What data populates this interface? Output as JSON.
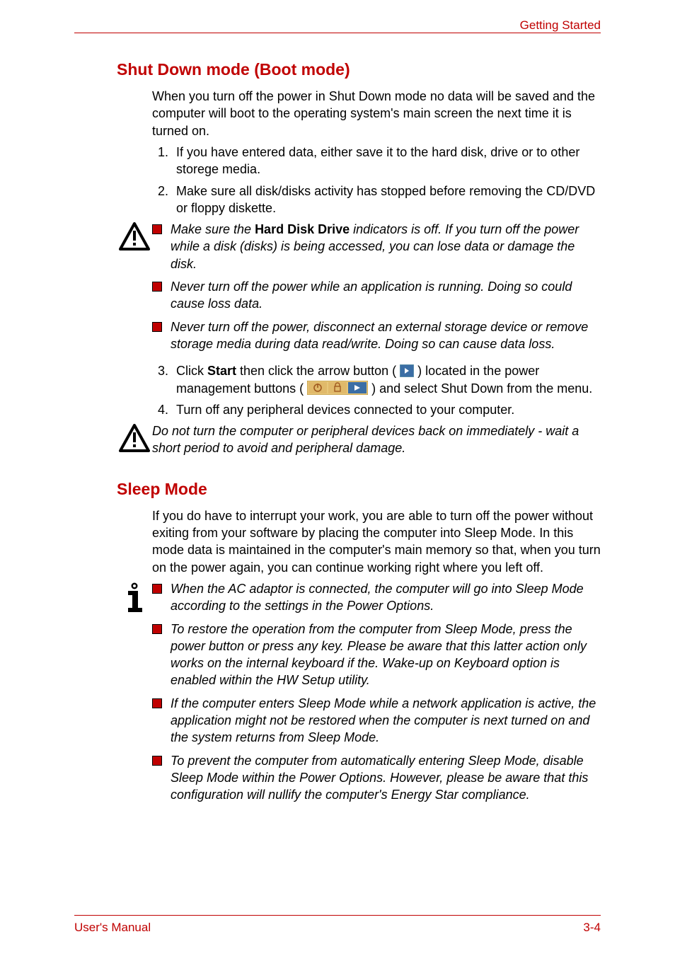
{
  "header": {
    "section_name": "Getting Started"
  },
  "sections": {
    "shutdown": {
      "heading": "Shut Down mode (Boot mode)",
      "intro": "When you turn off the power in Shut Down mode no data will be saved and the computer will boot to the operating system's main screen the next time it is turned on.",
      "steps_a": {
        "s1": "If you have entered data, either save it to the hard disk, drive or to other storege media.",
        "s2": "Make sure all disk/disks activity has stopped before removing the CD/DVD or floppy diskette."
      },
      "warning1": {
        "b1_pre": "Make sure the ",
        "b1_strong": "Hard Disk Drive",
        "b1_post": " indicators is off. If you turn off the power while a disk (disks) is being accessed, you can lose data or damage the disk.",
        "b2": "Never turn off the power while an application is running. Doing so could cause loss data.",
        "b3": "Never turn off the power, disconnect an external storage device or remove storage media during data read/write. Doing so can cause data loss."
      },
      "steps_b": {
        "s3_pre": "Click ",
        "s3_strong": "Start",
        "s3_mid1": " then click the arrow button ( ",
        "s3_mid2": " ) located in the power management buttons ( ",
        "s3_post": " ) and select Shut Down from the menu.",
        "s4": "Turn off any peripheral devices connected to your computer."
      },
      "warning2": "Do not turn the computer or peripheral devices back on immediately - wait a short period to avoid and peripheral damage."
    },
    "sleep": {
      "heading": "Sleep Mode",
      "intro": "If you do have to interrupt your work, you are able to turn off the power without exiting from your software by placing the computer into Sleep Mode. In this mode data is maintained in the computer's main memory so that, when you turn on the power again, you can continue working right where you left off.",
      "notes": {
        "n1": "When the AC adaptor is connected, the computer will go into Sleep Mode according to the settings in the Power Options.",
        "n2": "To restore the operation from the computer from Sleep Mode, press the power button or press any key. Please be aware that this latter action only works on the internal keyboard if the. Wake-up on Keyboard option is enabled within the HW Setup utility.",
        "n3": "If the computer enters Sleep Mode while a network application is active, the application might not be restored when the computer is next turned on and the system returns from Sleep Mode.",
        "n4": "To prevent the computer from automatically entering Sleep Mode, disable Sleep Mode within the Power Options. However, please be aware that this configuration will nullify the computer's Energy Star compliance."
      }
    }
  },
  "footer": {
    "left": "User's Manual",
    "right": "3-4"
  }
}
